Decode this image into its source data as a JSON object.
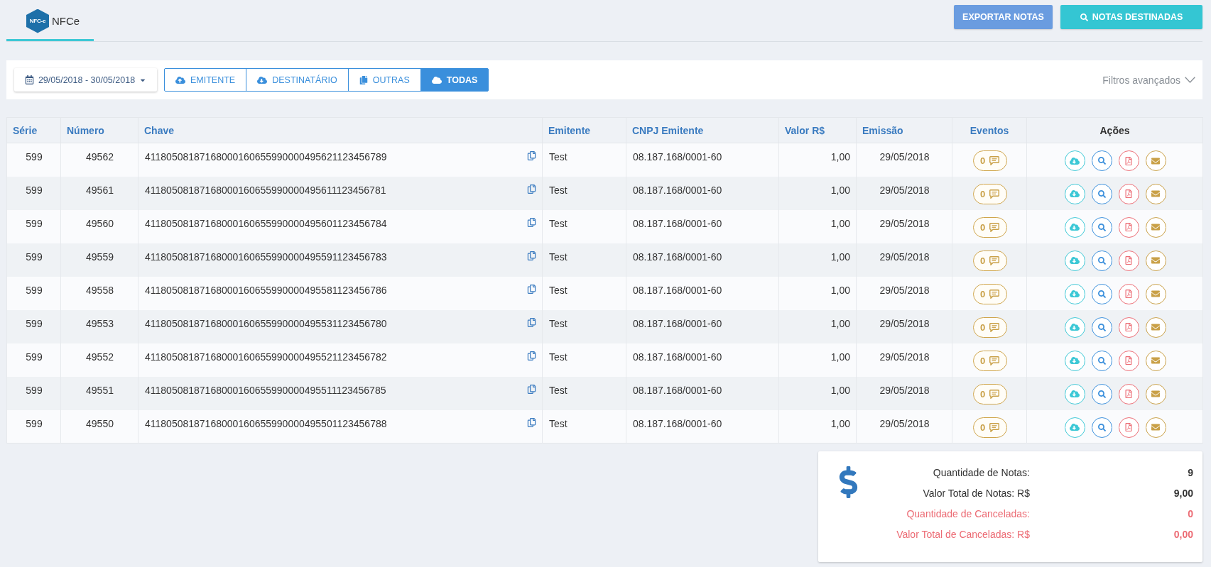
{
  "tabs": [
    {
      "label": "NFCe",
      "logo_text": "NFC-e",
      "selected": true
    }
  ],
  "header_buttons": [
    {
      "label": "EXPORTAR NOTAS",
      "kind": "export"
    },
    {
      "label": "NOTAS DESTINADAS",
      "kind": "search"
    }
  ],
  "filters": {
    "date_range": "29/05/2018 - 30/05/2018",
    "segments": [
      {
        "label": "EMITENTE",
        "kind": "upload",
        "selected": false
      },
      {
        "label": "DESTINATÁRIO",
        "kind": "download",
        "selected": false
      },
      {
        "label": "OUTRAS",
        "kind": "files",
        "selected": false
      },
      {
        "label": "TODAS",
        "kind": "cloud",
        "selected": true
      }
    ],
    "advanced_filters": "Filtros avançados"
  },
  "table": {
    "columns": [
      {
        "label": "Série",
        "sortable": true
      },
      {
        "label": "Número",
        "sortable": true
      },
      {
        "label": "Chave",
        "sortable": true
      },
      {
        "label": "Emitente",
        "sortable": true
      },
      {
        "label": "CNPJ Emitente",
        "sortable": true
      },
      {
        "label": "Valor R$",
        "sortable": true
      },
      {
        "label": "Emissão",
        "sortable": true
      },
      {
        "label": "Eventos",
        "sortable": true
      },
      {
        "label": "Ações",
        "sortable": false
      }
    ],
    "rows": [
      {
        "serie": "599",
        "numero": "49562",
        "chave": "41180508187168000160655990000495621123456789",
        "emitente": "Test",
        "cnpj_emitente": "08.187.168/0001-60",
        "valor": "1,00",
        "emissao": "29/05/2018",
        "eventos": "0"
      },
      {
        "serie": "599",
        "numero": "49561",
        "chave": "41180508187168000160655990000495611123456781",
        "emitente": "Test",
        "cnpj_emitente": "08.187.168/0001-60",
        "valor": "1,00",
        "emissao": "29/05/2018",
        "eventos": "0"
      },
      {
        "serie": "599",
        "numero": "49560",
        "chave": "41180508187168000160655990000495601123456784",
        "emitente": "Test",
        "cnpj_emitente": "08.187.168/0001-60",
        "valor": "1,00",
        "emissao": "29/05/2018",
        "eventos": "0"
      },
      {
        "serie": "599",
        "numero": "49559",
        "chave": "41180508187168000160655990000495591123456783",
        "emitente": "Test",
        "cnpj_emitente": "08.187.168/0001-60",
        "valor": "1,00",
        "emissao": "29/05/2018",
        "eventos": "0"
      },
      {
        "serie": "599",
        "numero": "49558",
        "chave": "41180508187168000160655990000495581123456786",
        "emitente": "Test",
        "cnpj_emitente": "08.187.168/0001-60",
        "valor": "1,00",
        "emissao": "29/05/2018",
        "eventos": "0"
      },
      {
        "serie": "599",
        "numero": "49553",
        "chave": "41180508187168000160655990000495531123456780",
        "emitente": "Test",
        "cnpj_emitente": "08.187.168/0001-60",
        "valor": "1,00",
        "emissao": "29/05/2018",
        "eventos": "0"
      },
      {
        "serie": "599",
        "numero": "49552",
        "chave": "41180508187168000160655990000495521123456782",
        "emitente": "Test",
        "cnpj_emitente": "08.187.168/0001-60",
        "valor": "1,00",
        "emissao": "29/05/2018",
        "eventos": "0"
      },
      {
        "serie": "599",
        "numero": "49551",
        "chave": "41180508187168000160655990000495511123456785",
        "emitente": "Test",
        "cnpj_emitente": "08.187.168/0001-60",
        "valor": "1,00",
        "emissao": "29/05/2018",
        "eventos": "0"
      },
      {
        "serie": "599",
        "numero": "49550",
        "chave": "41180508187168000160655990000495501123456788",
        "emitente": "Test",
        "cnpj_emitente": "08.187.168/0001-60",
        "valor": "1,00",
        "emissao": "29/05/2018",
        "eventos": "0"
      }
    ]
  },
  "summary": {
    "items": [
      {
        "label": "Quantidade de Notas:",
        "value": "9",
        "kind": "total"
      },
      {
        "label": "Valor Total de Notas: R$",
        "value": "9,00",
        "kind": "total"
      },
      {
        "label": "Quantidade de Canceladas:",
        "value": "0",
        "kind": "cancelled"
      },
      {
        "label": "Valor Total de Canceladas: R$",
        "value": "0,00",
        "kind": "cancelled"
      }
    ]
  }
}
